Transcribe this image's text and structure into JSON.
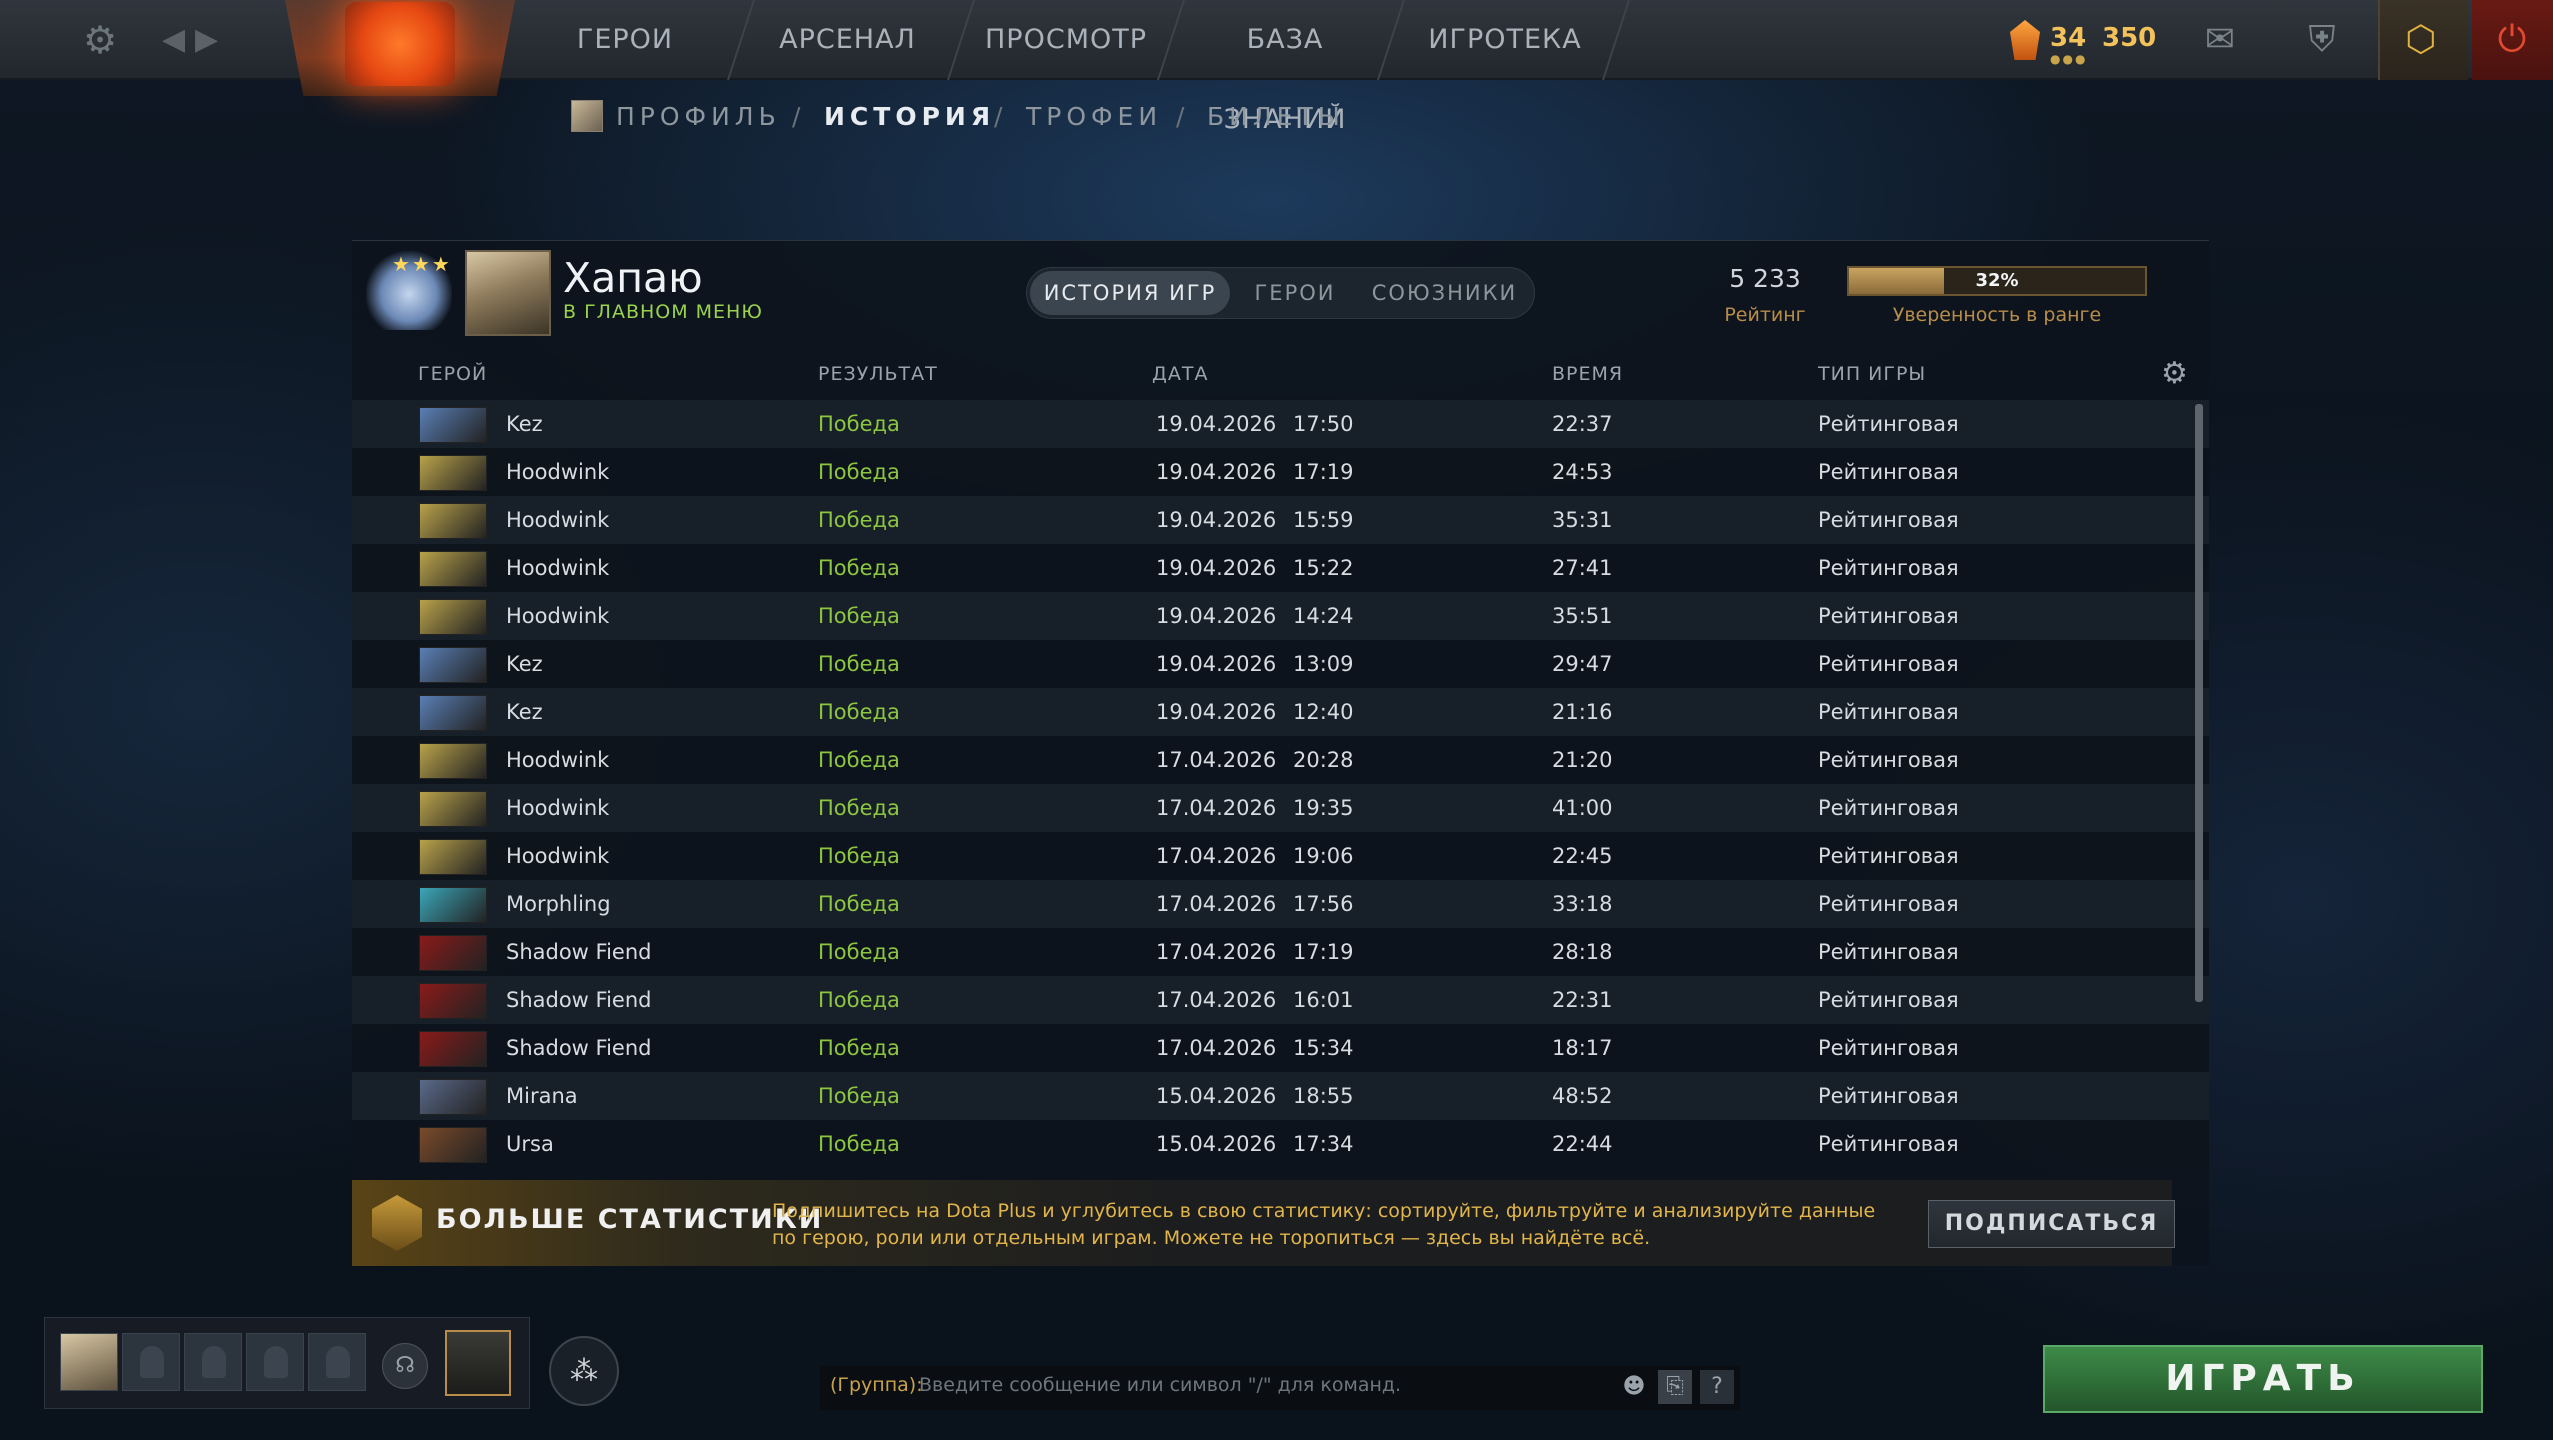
{
  "topnav": {
    "items": [
      "ГЕРОИ",
      "АРСЕНАЛ",
      "ПРОСМОТР",
      "БАЗА ЗНАНИЙ",
      "ИГРОТЕКА"
    ],
    "shards_small": "34",
    "shards": "350"
  },
  "breadcrumb": [
    "ПРОФИЛЬ",
    "ИСТОРИЯ",
    "ТРОФЕИ",
    "БИЛЕТЫ"
  ],
  "breadcrumb_sep": "/",
  "profile": {
    "name": "Хапаю",
    "status": "В ГЛАВНОМ МЕНЮ",
    "rating": "5 233",
    "rating_label": "Рейтинг",
    "confidence": "32%",
    "confidence_value": 0.32,
    "confidence_label": "Уверенность в ранге"
  },
  "tabs": [
    "ИСТОРИЯ ИГР",
    "ГЕРОИ",
    "СОЮЗНИКИ"
  ],
  "table": {
    "headers": [
      "ГЕРОЙ",
      "РЕЗУЛЬТАТ",
      "ДАТА",
      "ВРЕМЯ",
      "ТИП ИГРЫ"
    ],
    "rows": [
      {
        "hero": "Kez",
        "result": "Победа",
        "date": "19.04.2026",
        "time": "17:50",
        "duration": "22:37",
        "type": "Рейтинговая",
        "icon": "#5a7fb5"
      },
      {
        "hero": "Hoodwink",
        "result": "Победа",
        "date": "19.04.2026",
        "time": "17:19",
        "duration": "24:53",
        "type": "Рейтинговая",
        "icon": "#b8a24a"
      },
      {
        "hero": "Hoodwink",
        "result": "Победа",
        "date": "19.04.2026",
        "time": "15:59",
        "duration": "35:31",
        "type": "Рейтинговая",
        "icon": "#b8a24a"
      },
      {
        "hero": "Hoodwink",
        "result": "Победа",
        "date": "19.04.2026",
        "time": "15:22",
        "duration": "27:41",
        "type": "Рейтинговая",
        "icon": "#b8a24a"
      },
      {
        "hero": "Hoodwink",
        "result": "Победа",
        "date": "19.04.2026",
        "time": "14:24",
        "duration": "35:51",
        "type": "Рейтинговая",
        "icon": "#b8a24a"
      },
      {
        "hero": "Kez",
        "result": "Победа",
        "date": "19.04.2026",
        "time": "13:09",
        "duration": "29:47",
        "type": "Рейтинговая",
        "icon": "#5a7fb5"
      },
      {
        "hero": "Kez",
        "result": "Победа",
        "date": "19.04.2026",
        "time": "12:40",
        "duration": "21:16",
        "type": "Рейтинговая",
        "icon": "#5a7fb5"
      },
      {
        "hero": "Hoodwink",
        "result": "Победа",
        "date": "17.04.2026",
        "time": "20:28",
        "duration": "21:20",
        "type": "Рейтинговая",
        "icon": "#b8a24a"
      },
      {
        "hero": "Hoodwink",
        "result": "Победа",
        "date": "17.04.2026",
        "time": "19:35",
        "duration": "41:00",
        "type": "Рейтинговая",
        "icon": "#b8a24a"
      },
      {
        "hero": "Hoodwink",
        "result": "Победа",
        "date": "17.04.2026",
        "time": "19:06",
        "duration": "22:45",
        "type": "Рейтинговая",
        "icon": "#b8a24a"
      },
      {
        "hero": "Morphling",
        "result": "Победа",
        "date": "17.04.2026",
        "time": "17:56",
        "duration": "33:18",
        "type": "Рейтинговая",
        "icon": "#3aa6b8"
      },
      {
        "hero": "Shadow Fiend",
        "result": "Победа",
        "date": "17.04.2026",
        "time": "17:19",
        "duration": "28:18",
        "type": "Рейтинговая",
        "icon": "#8a1a1a"
      },
      {
        "hero": "Shadow Fiend",
        "result": "Победа",
        "date": "17.04.2026",
        "time": "16:01",
        "duration": "22:31",
        "type": "Рейтинговая",
        "icon": "#8a1a1a"
      },
      {
        "hero": "Shadow Fiend",
        "result": "Победа",
        "date": "17.04.2026",
        "time": "15:34",
        "duration": "18:17",
        "type": "Рейтинговая",
        "icon": "#8a1a1a"
      },
      {
        "hero": "Mirana",
        "result": "Победа",
        "date": "15.04.2026",
        "time": "18:55",
        "duration": "48:52",
        "type": "Рейтинговая",
        "icon": "#5a6a8a"
      },
      {
        "hero": "Ursa",
        "result": "Победа",
        "date": "15.04.2026",
        "time": "17:34",
        "duration": "22:44",
        "type": "Рейтинговая",
        "icon": "#7a4a2a"
      }
    ]
  },
  "promo": {
    "title": "БОЛЬШЕ СТАТИСТИКИ",
    "text": "Подпишитесь на Dota Plus и углубитесь в свою статистику: сортируйте, фильтруйте и анализируйте данные по герою, роли или отдельным играм. Можете не торопиться — здесь вы найдёте всё.",
    "button": "ПОДПИСАТЬСЯ"
  },
  "chat": {
    "prefix": "(Группа):",
    "placeholder": "Введите сообщение или символ \"/\" для команд.",
    "help": "?"
  },
  "play_button": "ИГРАТЬ",
  "colors": {
    "win": "#8cc63f",
    "accent": "#b88d4a",
    "play": "#3e8a48"
  }
}
